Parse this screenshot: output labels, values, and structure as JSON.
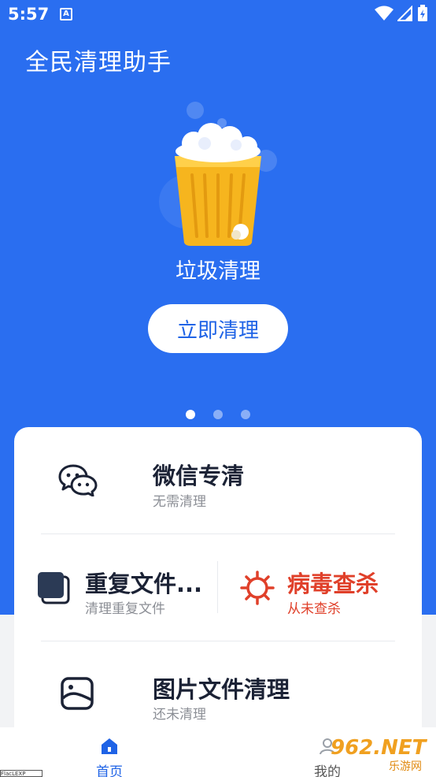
{
  "status_bar": {
    "time": "5:57",
    "notification_badge": "A"
  },
  "header": {
    "title": "全民清理助手"
  },
  "hero": {
    "caption": "垃圾清理",
    "clean_button": "立即清理",
    "carousel": {
      "pages": 3,
      "active_index": 0
    }
  },
  "features": {
    "wechat": {
      "title": "微信专清",
      "subtitle": "无需清理",
      "icon": "wechat-icon"
    },
    "duplicate": {
      "title": "重复文件...",
      "subtitle": "清理重复文件",
      "icon": "duplicate-files-icon"
    },
    "virus": {
      "title": "病毒查杀",
      "subtitle": "从未查杀",
      "icon": "virus-icon",
      "accent": "#e0402a"
    },
    "images": {
      "title": "图片文件清理",
      "subtitle": "还未清理",
      "icon": "image-icon"
    }
  },
  "tabbar": {
    "home": {
      "label": "首页",
      "icon": "home-icon",
      "active": true
    },
    "mine": {
      "label": "我的",
      "icon": "user-icon",
      "active": false
    }
  },
  "colors": {
    "primary": "#2a6ef0",
    "text_dark": "#1b2235",
    "danger": "#e0402a",
    "muted": "#8c8f96"
  },
  "watermark": {
    "logo": "962.NET",
    "site": "乐游网"
  },
  "corner_tag": "FlacLEXP"
}
